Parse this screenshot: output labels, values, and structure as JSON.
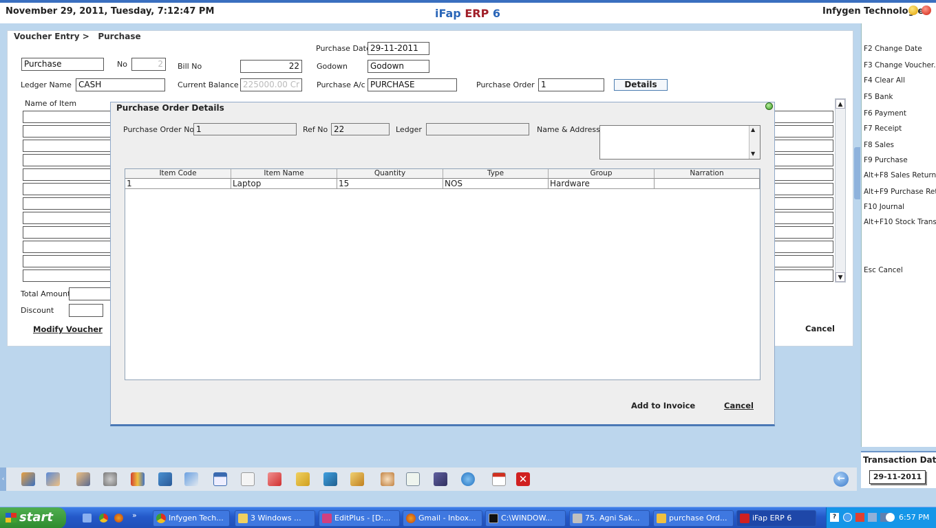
{
  "header": {
    "datetime": "November  29, 2011, Tuesday, 7:12:47 PM",
    "app_name": "iFap",
    "app_erp": "ERP",
    "app_version": "6",
    "company": "Infygen Technologies"
  },
  "breadcrumb": {
    "section": "Voucher Entry >",
    "page": "Purchase"
  },
  "form": {
    "purchase_date_label": "Purchase Date",
    "purchase_date": "29-11-2011",
    "voucher_type": "Purchase",
    "no_label": "No",
    "no_value": "2",
    "bill_no_label": "Bill No",
    "bill_no": "22",
    "godown_label": "Godown",
    "godown": "Godown",
    "ledger_name_label": "Ledger Name",
    "ledger_name": "CASH",
    "current_balance_label": "Current Balance",
    "current_balance": "225000.00 Cr",
    "purchase_ac_label": "Purchase A/c",
    "purchase_ac": "PURCHASE",
    "purchase_order_label": "Purchase Order",
    "purchase_order": "1",
    "details_button": "Details",
    "name_of_item_label": "Name of Item",
    "total_amount_label": "Total Amount",
    "discount_label": "Discount",
    "modify_voucher_button": "Modify Voucher",
    "cancel_button": "Cancel"
  },
  "shortcuts": [
    "F2 Change Date",
    "F3 Change Voucher...",
    "F4 Clear All",
    "F5 Bank",
    "F6 Payment",
    "F7 Receipt",
    "F8 Sales",
    "F9 Purchase",
    "Alt+F8 Sales Return",
    "Alt+F9 Purchase Ret",
    "F10 Journal",
    "Alt+F10 Stock Trans",
    "Esc Cancel"
  ],
  "transaction": {
    "label": "Transaction Date",
    "date": "29-11-2011"
  },
  "dialog": {
    "title": "Purchase Order Details",
    "po_no_label": "Purchase Order No",
    "po_no": "1",
    "ref_no_label": "Ref No",
    "ref_no": "22",
    "ledger_label": "Ledger",
    "ledger": "",
    "name_address_label": "Name & Address",
    "columns": [
      "Item Code",
      "Item Name",
      "Quantity",
      "Type",
      "Group",
      "Narration"
    ],
    "rows": [
      [
        "1",
        "Laptop",
        "15",
        "NOS",
        "Hardware",
        ""
      ]
    ],
    "add_button": "Add to Invoice",
    "cancel_button": "Cancel"
  },
  "toolbar_icons": [
    "accounts-icon",
    "user-icon",
    "users-icon",
    "settings-gears-icon",
    "books-icon",
    "cart-icon",
    "transfer-icon",
    "window-icon",
    "document-icon",
    "chart-icon",
    "folder-tree-icon",
    "network-icon",
    "package-icon",
    "support-icon",
    "calculator-icon",
    "save-icon",
    "gear-icon",
    "calendar-icon",
    "close-icon"
  ],
  "taskbar": {
    "start": "start",
    "tasks": [
      "Infygen Tech...",
      "3 Windows ...",
      "EditPlus - [D:...",
      "Gmail - Inbox...",
      "C:\\WINDOW...",
      "75. Agni Sak...",
      "purchase Ord...",
      "iFap ERP 6"
    ],
    "clock": "6:57 PM"
  }
}
